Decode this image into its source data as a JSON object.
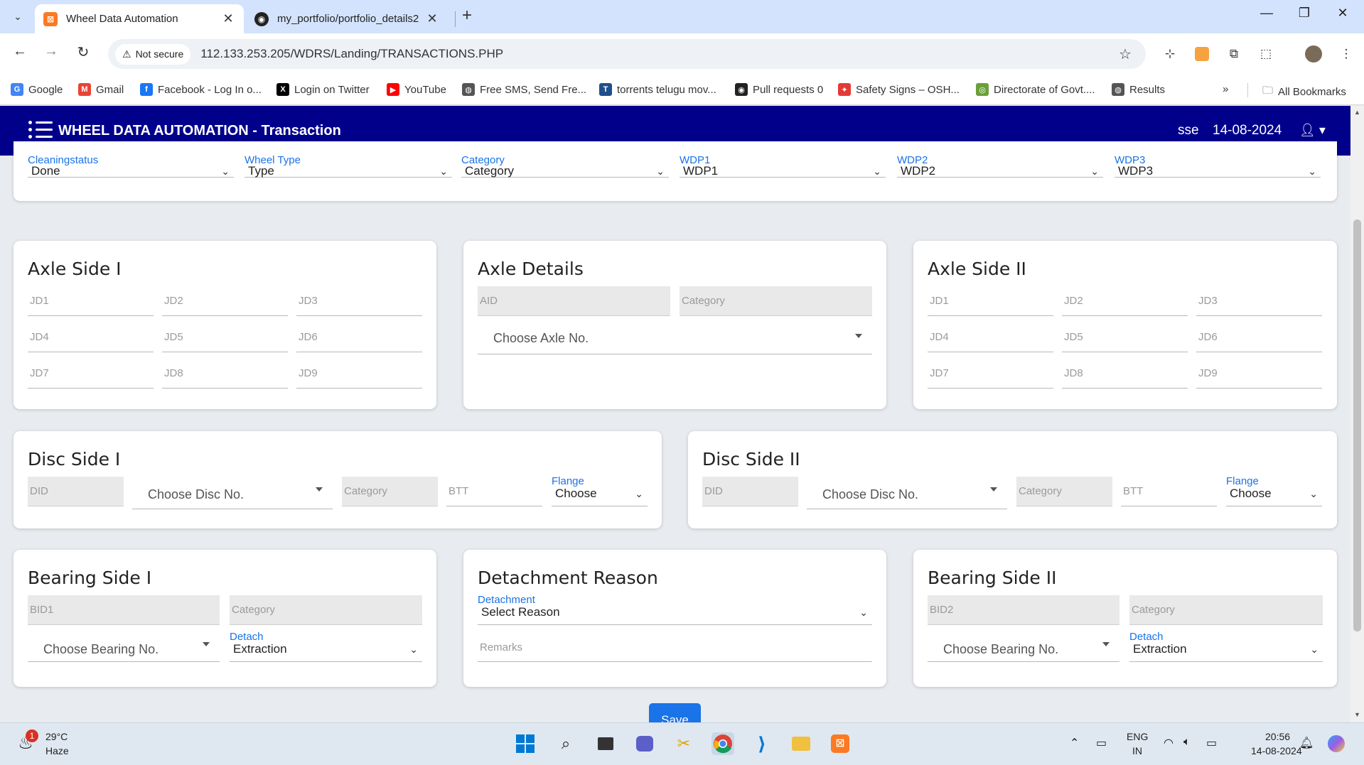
{
  "browser": {
    "tabs": [
      {
        "title": "Wheel Data Automation",
        "active": true
      },
      {
        "title": "my_portfolio/portfolio_details2",
        "active": false
      }
    ],
    "new_tab": "+",
    "tab_close": "✕",
    "window": {
      "minimize": "—",
      "restore": "❐",
      "close": "✕"
    },
    "nav": {
      "back": "←",
      "forward": "→",
      "reload": "↻"
    },
    "security_label": "Not secure",
    "url": "112.133.253.205/WDRS/Landing/TRANSACTIONS.PHP",
    "bookmarks": [
      {
        "label": "Google",
        "icon": "G",
        "color": "#4285f4"
      },
      {
        "label": "Gmail",
        "icon": "M",
        "color": "#ea4335"
      },
      {
        "label": "Facebook - Log In o...",
        "icon": "f",
        "color": "#1877f2"
      },
      {
        "label": "Login on Twitter",
        "icon": "X",
        "color": "#000000"
      },
      {
        "label": "YouTube",
        "icon": "▶",
        "color": "#ff0000"
      },
      {
        "label": "Free SMS, Send Fre...",
        "icon": "◍",
        "color": "#555555"
      },
      {
        "label": "torrents telugu mov...",
        "icon": "T",
        "color": "#1e4f8c"
      },
      {
        "label": "Pull requests 0",
        "icon": "◉",
        "color": "#222222"
      },
      {
        "label": "Safety Signs – OSH...",
        "icon": "✦",
        "color": "#e53935"
      },
      {
        "label": "Directorate of Govt....",
        "icon": "◎",
        "color": "#6a9f3a"
      },
      {
        "label": "Results",
        "icon": "◍",
        "color": "#555555"
      }
    ],
    "more_bookmarks": "»",
    "all_bookmarks": "All Bookmarks"
  },
  "header": {
    "title": "WHEEL DATA AUTOMATION - Transaction",
    "user": "sse",
    "date": "14-08-2024",
    "bg_color": "#00008b"
  },
  "filters": [
    {
      "label": "Cleaningstatus",
      "value": "Done"
    },
    {
      "label": "Wheel Type",
      "value": "Type"
    },
    {
      "label": "Category",
      "value": "Category"
    },
    {
      "label": "WDP1",
      "value": "WDP1"
    },
    {
      "label": "WDP2",
      "value": "WDP2"
    },
    {
      "label": "WDP3",
      "value": "WDP3"
    }
  ],
  "axle_side_1": {
    "title": "Axle Side I",
    "fields": [
      "JD1",
      "JD2",
      "JD3",
      "JD4",
      "JD5",
      "JD6",
      "JD7",
      "JD8",
      "JD9"
    ]
  },
  "axle_details": {
    "title": "Axle Details",
    "aid": "AID",
    "category": "Category",
    "choose": "Choose Axle No."
  },
  "axle_side_2": {
    "title": "Axle Side II",
    "fields": [
      "JD1",
      "JD2",
      "JD3",
      "JD4",
      "JD5",
      "JD6",
      "JD7",
      "JD8",
      "JD9"
    ]
  },
  "disc_side_1": {
    "title": "Disc Side I",
    "did": "DID",
    "choose": "Choose Disc No.",
    "category": "Category",
    "btt": "BTT",
    "flange_label": "Flange",
    "flange_value": "Choose"
  },
  "disc_side_2": {
    "title": "Disc Side II",
    "did": "DID",
    "choose": "Choose Disc No.",
    "category": "Category",
    "btt": "BTT",
    "flange_label": "Flange",
    "flange_value": "Choose"
  },
  "bearing_side_1": {
    "title": "Bearing Side I",
    "bid": "BID1",
    "category": "Category",
    "choose": "Choose Bearing No.",
    "detach_label": "Detach",
    "detach_value": "Extraction"
  },
  "detachment_reason": {
    "title": "Detachment Reason",
    "label": "Detachment",
    "value": "Select Reason",
    "remarks": "Remarks"
  },
  "bearing_side_2": {
    "title": "Bearing Side II",
    "bid": "BID2",
    "category": "Category",
    "choose": "Choose Bearing No.",
    "detach_label": "Detach",
    "detach_value": "Extraction"
  },
  "save_label": "Save",
  "taskbar": {
    "weather_temp": "29°C",
    "weather_desc": "Haze",
    "weather_badge": "1",
    "lang": "ENG",
    "region": "IN",
    "time": "20:56",
    "date": "14-08-2024"
  }
}
